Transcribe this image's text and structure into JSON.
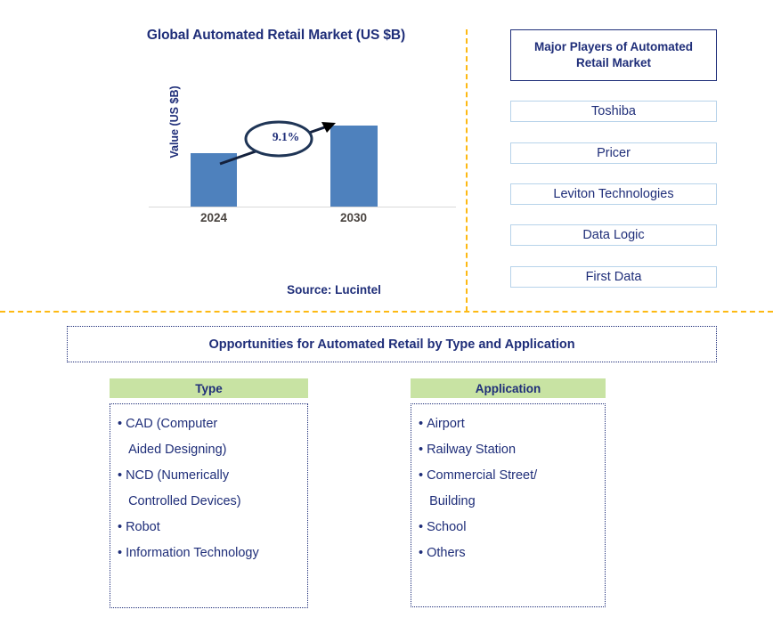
{
  "chart_panel": {
    "title": "Global Automated Retail Market (US $B)",
    "source": "Source: Lucintel"
  },
  "chart_data": {
    "type": "bar",
    "title": "Global Automated Retail Market (US $B)",
    "categories": [
      "2024",
      "2030"
    ],
    "values": [
      60,
      91
    ],
    "xlabel": "",
    "ylabel": "Value (US $B)",
    "ylim": [
      0,
      100
    ],
    "grid": false,
    "legend": "none",
    "series": [
      {
        "name": "Value (US $B)",
        "values": [
          60,
          91
        ]
      }
    ],
    "annotations": [
      {
        "label": "9.1%",
        "type": "cagr-callout",
        "from": "2024",
        "to": "2030"
      }
    ],
    "bar_color": "#4E81BD",
    "tick_label_color": "#4a4440",
    "title_color": "#1F2E79"
  },
  "players_panel": {
    "header": "Major Players of Automated Retail Market",
    "items": [
      {
        "label": "Toshiba"
      },
      {
        "label": "Pricer"
      },
      {
        "label": "Leviton Technologies"
      },
      {
        "label": "Data Logic"
      },
      {
        "label": "First Data"
      }
    ]
  },
  "opportunities": {
    "heading": "Opportunities for Automated Retail by Type and Application",
    "columns": [
      {
        "header": "Type",
        "items": [
          "CAD (Computer",
          "Aided Designing)",
          "NCD (Numerically",
          "Controlled Devices)",
          "Robot",
          "Information Technology"
        ],
        "bulleted": [
          true,
          false,
          true,
          false,
          true,
          true
        ]
      },
      {
        "header": "Application",
        "items": [
          "Airport",
          "Railway Station",
          "Commercial Street/",
          "Building",
          "School",
          "Others"
        ],
        "bulleted": [
          true,
          true,
          true,
          false,
          true,
          true
        ]
      }
    ]
  },
  "colors": {
    "navy": "#1F2E79",
    "bar_blue": "#4E81BD",
    "divider_amber": "#FDB913",
    "header_green": "#C8E3A3",
    "player_border": "#b7d3ea"
  }
}
